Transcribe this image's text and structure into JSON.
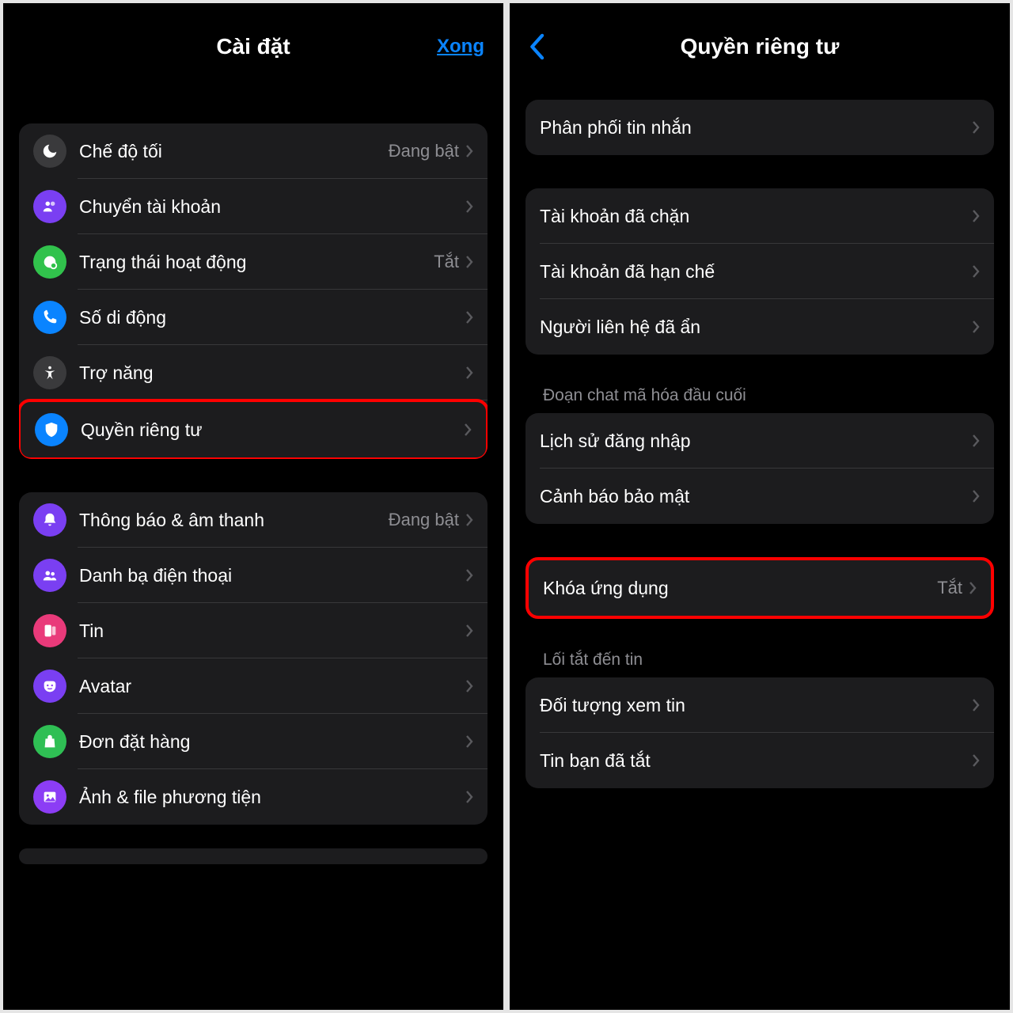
{
  "left": {
    "title": "Cài đặt",
    "done": "Xong",
    "group1": [
      {
        "label": "Chế độ tối",
        "value": "Đang bật"
      },
      {
        "label": "Chuyển tài khoản"
      },
      {
        "label": "Trạng thái hoạt động",
        "value": "Tắt"
      },
      {
        "label": "Số di động"
      },
      {
        "label": "Trợ năng"
      },
      {
        "label": "Quyền riêng tư"
      }
    ],
    "group2": [
      {
        "label": "Thông báo & âm thanh",
        "value": "Đang bật"
      },
      {
        "label": "Danh bạ điện thoại"
      },
      {
        "label": "Tin"
      },
      {
        "label": "Avatar"
      },
      {
        "label": "Đơn đặt hàng"
      },
      {
        "label": "Ảnh & file phương tiện"
      }
    ]
  },
  "right": {
    "title": "Quyền riêng tư",
    "group1": [
      {
        "label": "Phân phối tin nhắn"
      }
    ],
    "group2": [
      {
        "label": "Tài khoản đã chặn"
      },
      {
        "label": "Tài khoản đã hạn chế"
      },
      {
        "label": "Người liên hệ đã ẩn"
      }
    ],
    "section3_header": "Đoạn chat mã hóa đầu cuối",
    "group3": [
      {
        "label": "Lịch sử đăng nhập"
      },
      {
        "label": "Cảnh báo bảo mật"
      }
    ],
    "group4": [
      {
        "label": "Khóa ứng dụng",
        "value": "Tắt"
      }
    ],
    "section5_header": "Lối tắt đến tin",
    "group5": [
      {
        "label": "Đối tượng xem tin"
      },
      {
        "label": "Tin bạn đã tắt"
      }
    ]
  }
}
